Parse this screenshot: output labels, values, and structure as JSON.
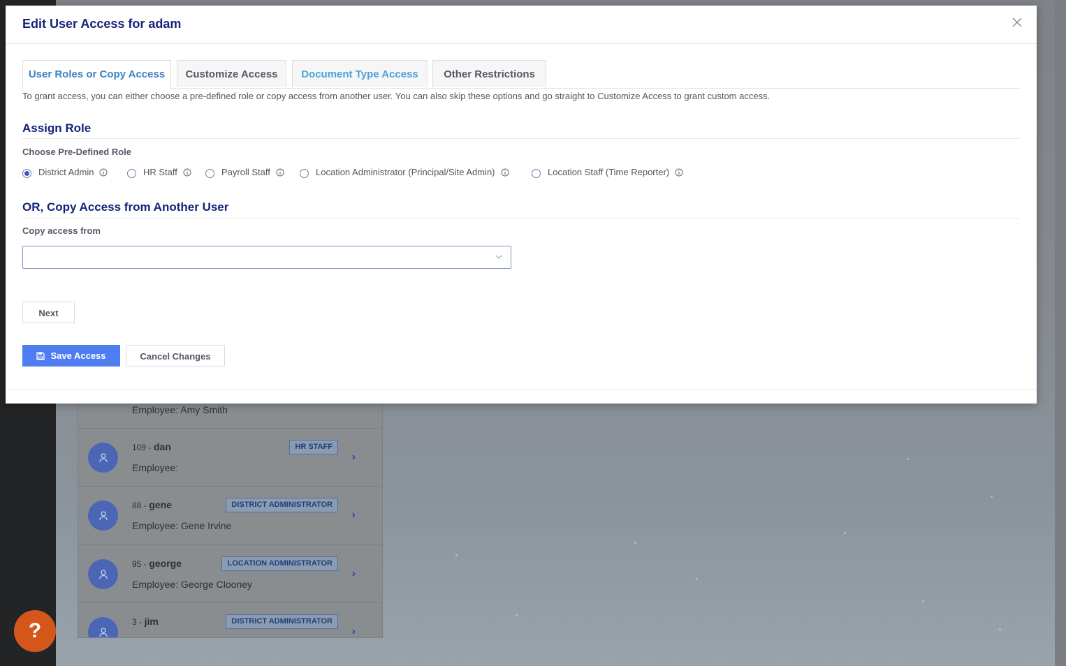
{
  "modal": {
    "title": "Edit User Access for adam",
    "tabs": [
      {
        "label": "User Roles or Copy Access"
      },
      {
        "label": "Customize Access"
      },
      {
        "label": "Document Type Access"
      },
      {
        "label": "Other Restrictions"
      }
    ],
    "intro": "To grant access, you can either choose a pre-defined role or copy access from another user. You can also skip these options and go straight to Customize Access to grant custom access.",
    "assign_role": {
      "title": "Assign Role",
      "label": "Choose Pre-Defined Role",
      "options": [
        {
          "label": "District Admin",
          "checked": true
        },
        {
          "label": "HR Staff",
          "checked": false
        },
        {
          "label": "Payroll Staff",
          "checked": false
        },
        {
          "label": "Location Administrator (Principal/Site Admin)",
          "checked": false
        },
        {
          "label": "Location Staff (Time Reporter)",
          "checked": false
        }
      ]
    },
    "copy_access": {
      "title": "OR, Copy Access from Another User",
      "label": "Copy access from",
      "value": ""
    },
    "buttons": {
      "next": "Next",
      "save": "Save Access",
      "cancel": "Cancel Changes"
    }
  },
  "background": {
    "users": [
      {
        "id": "",
        "name": "",
        "employee": "Employee: Amy Smith",
        "badge": ""
      },
      {
        "id": "109 -",
        "name": "dan",
        "employee": "Employee:",
        "badge": "HR STAFF"
      },
      {
        "id": "88 -",
        "name": "gene",
        "employee": "Employee: Gene Irvine",
        "badge": "DISTRICT ADMINISTRATOR"
      },
      {
        "id": "95 -",
        "name": "george",
        "employee": "Employee: George Clooney",
        "badge": "LOCATION ADMINISTRATOR"
      },
      {
        "id": "3 -",
        "name": "jim",
        "employee": "",
        "badge": "DISTRICT ADMINISTRATOR"
      }
    ],
    "help_label": "?"
  },
  "colors": {
    "title": "#15237a",
    "tab_active": "#3b82c4",
    "primary_button": "#4d7df0",
    "help_button": "#d4561a"
  }
}
